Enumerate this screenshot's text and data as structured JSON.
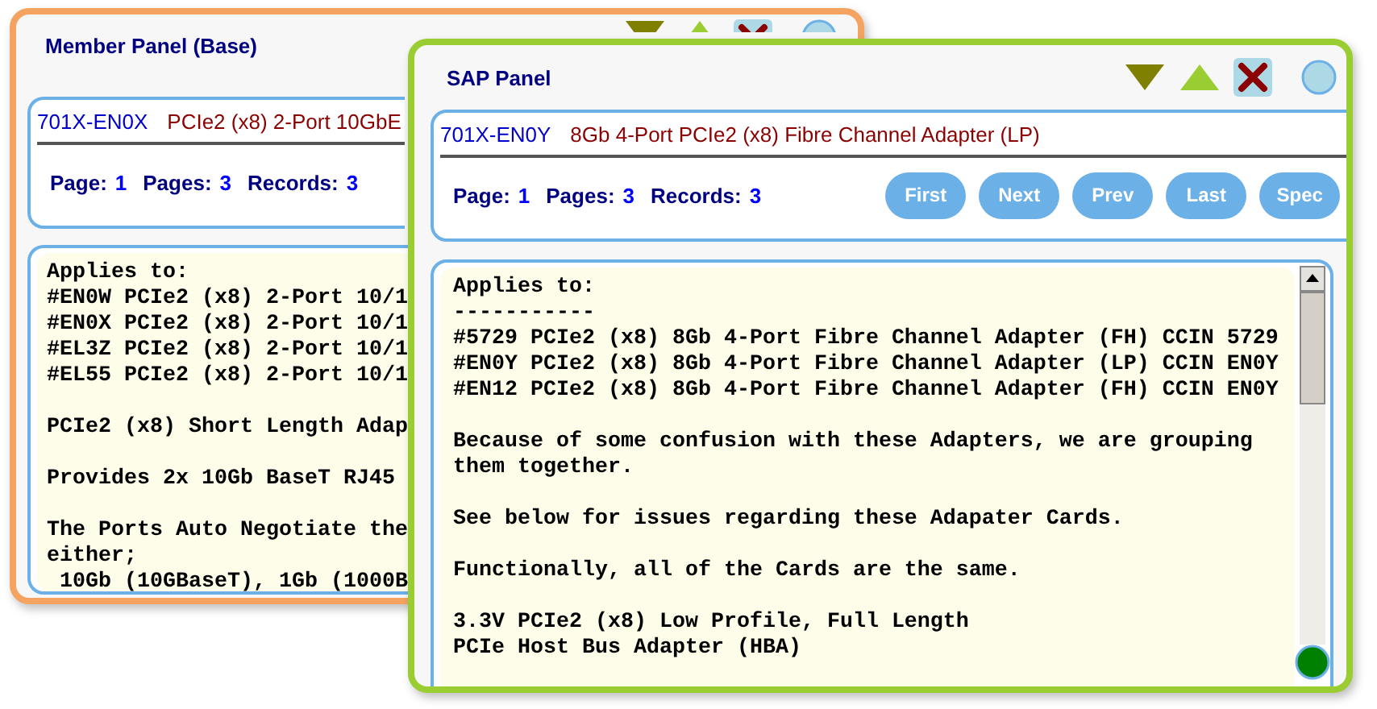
{
  "panels": [
    {
      "title": "Member Panel (Base)",
      "part_number": "701X-EN0X",
      "description": "PCIe2 (x8) 2-Port 10GbE",
      "page_label": "Page:",
      "page": "1",
      "pages_label": "Pages:",
      "pages": "3",
      "records_label": "Records:",
      "records": "3",
      "text": [
        "Applies to:\n#EN0W PCIe2 (x8) 2-Port 10/1\n#EN0X PCIe2 (x8) 2-Port 10/1\n#EL3Z PCIe2 (x8) 2-Port 10/1\n#EL55 PCIe2 (x8) 2-Port 10/1",
        "PCIe2 (x8) Short Length Adap",
        "Provides 2x 10Gb BaseT RJ45",
        "The Ports Auto Negotiate the\neither;\n 10Gb (10GBaseT), 1Gb (1000B"
      ]
    },
    {
      "title": "SAP Panel",
      "part_number": "701X-EN0Y",
      "description": "8Gb 4-Port PCIe2 (x8) Fibre Channel Adapter (LP)",
      "page_label": "Page:",
      "page": "1",
      "pages_label": "Pages:",
      "pages": "3",
      "records_label": "Records:",
      "records": "3",
      "buttons": [
        "First",
        "Next",
        "Prev",
        "Last",
        "Spec"
      ],
      "text": [
        "Applies to:\n-----------\n#5729 PCIe2 (x8) 8Gb 4-Port Fibre Channel Adapter (FH) CCIN 5729\n#EN0Y PCIe2 (x8) 8Gb 4-Port Fibre Channel Adapter (LP) CCIN EN0Y\n#EN12 PCIe2 (x8) 8Gb 4-Port Fibre Channel Adapter (FH) CCIN EN0Y",
        "Because of some confusion with these Adapters, we are grouping them together.",
        "See below for issues regarding these Adapater Cards.",
        "Functionally, all of the Cards are the same.",
        "3.3V PCIe2 (x8) Low Profile, Full Length\nPCIe Host Bus Adapter (HBA)"
      ]
    }
  ]
}
